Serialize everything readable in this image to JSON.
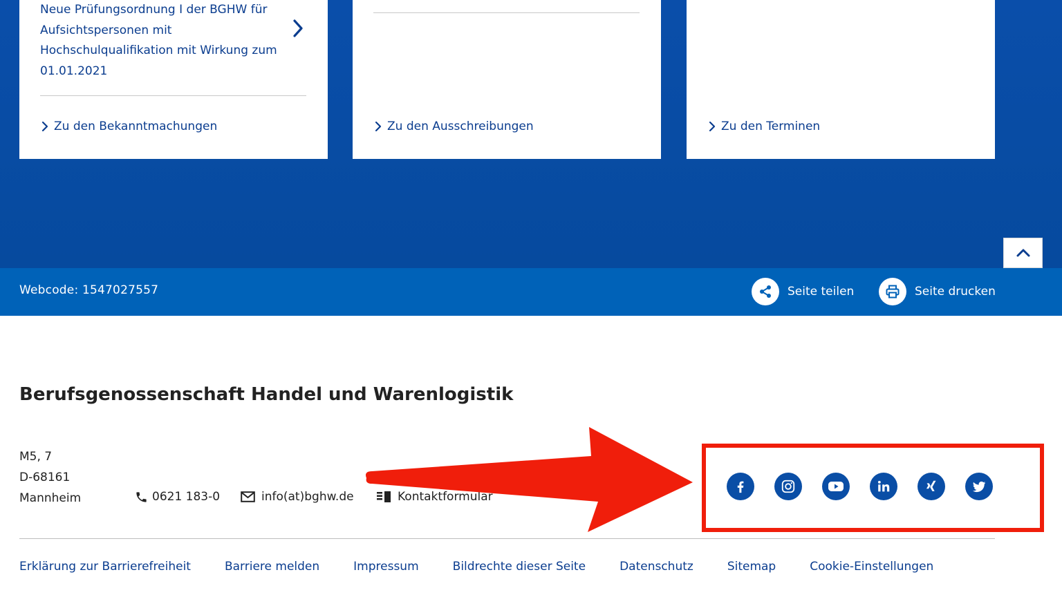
{
  "colors": {
    "primary_blue": "#0a4eaa",
    "utility_blue": "#0062b8",
    "link_blue": "#0b3d8f",
    "highlight_red": "#f01e0b"
  },
  "cards": [
    {
      "news_text": "Neue Prüfungsordnung I der BGHW für Aufsichtspersonen mit Hochschulqualifikation mit Wirkung zum 01.01.2021",
      "link_label": "Zu den Bekanntmachungen"
    },
    {
      "link_label": "Zu den Ausschreibungen"
    },
    {
      "link_label": "Zu den Terminen"
    }
  ],
  "utility_bar": {
    "webcode": "Webcode: 1547027557",
    "share_label": "Seite teilen",
    "print_label": "Seite drucken"
  },
  "footer": {
    "org_name": "Berufsgenossenschaft Handel und Warenlogistik",
    "address": {
      "line1": "M5, 7",
      "line2": "D-68161",
      "line3": "Mannheim"
    },
    "phone": "0621 183-0",
    "email": "info(at)bghw.de",
    "contact_form": "Kontaktformular",
    "social_icons": [
      "facebook-icon",
      "instagram-icon",
      "youtube-icon",
      "linkedin-icon",
      "xing-icon",
      "twitter-icon"
    ],
    "links": [
      "Erklärung zur Barrierefreiheit",
      "Barriere melden",
      "Impressum",
      "Bildrechte dieser Seite",
      "Datenschutz",
      "Sitemap",
      "Cookie-Einstellungen"
    ]
  }
}
